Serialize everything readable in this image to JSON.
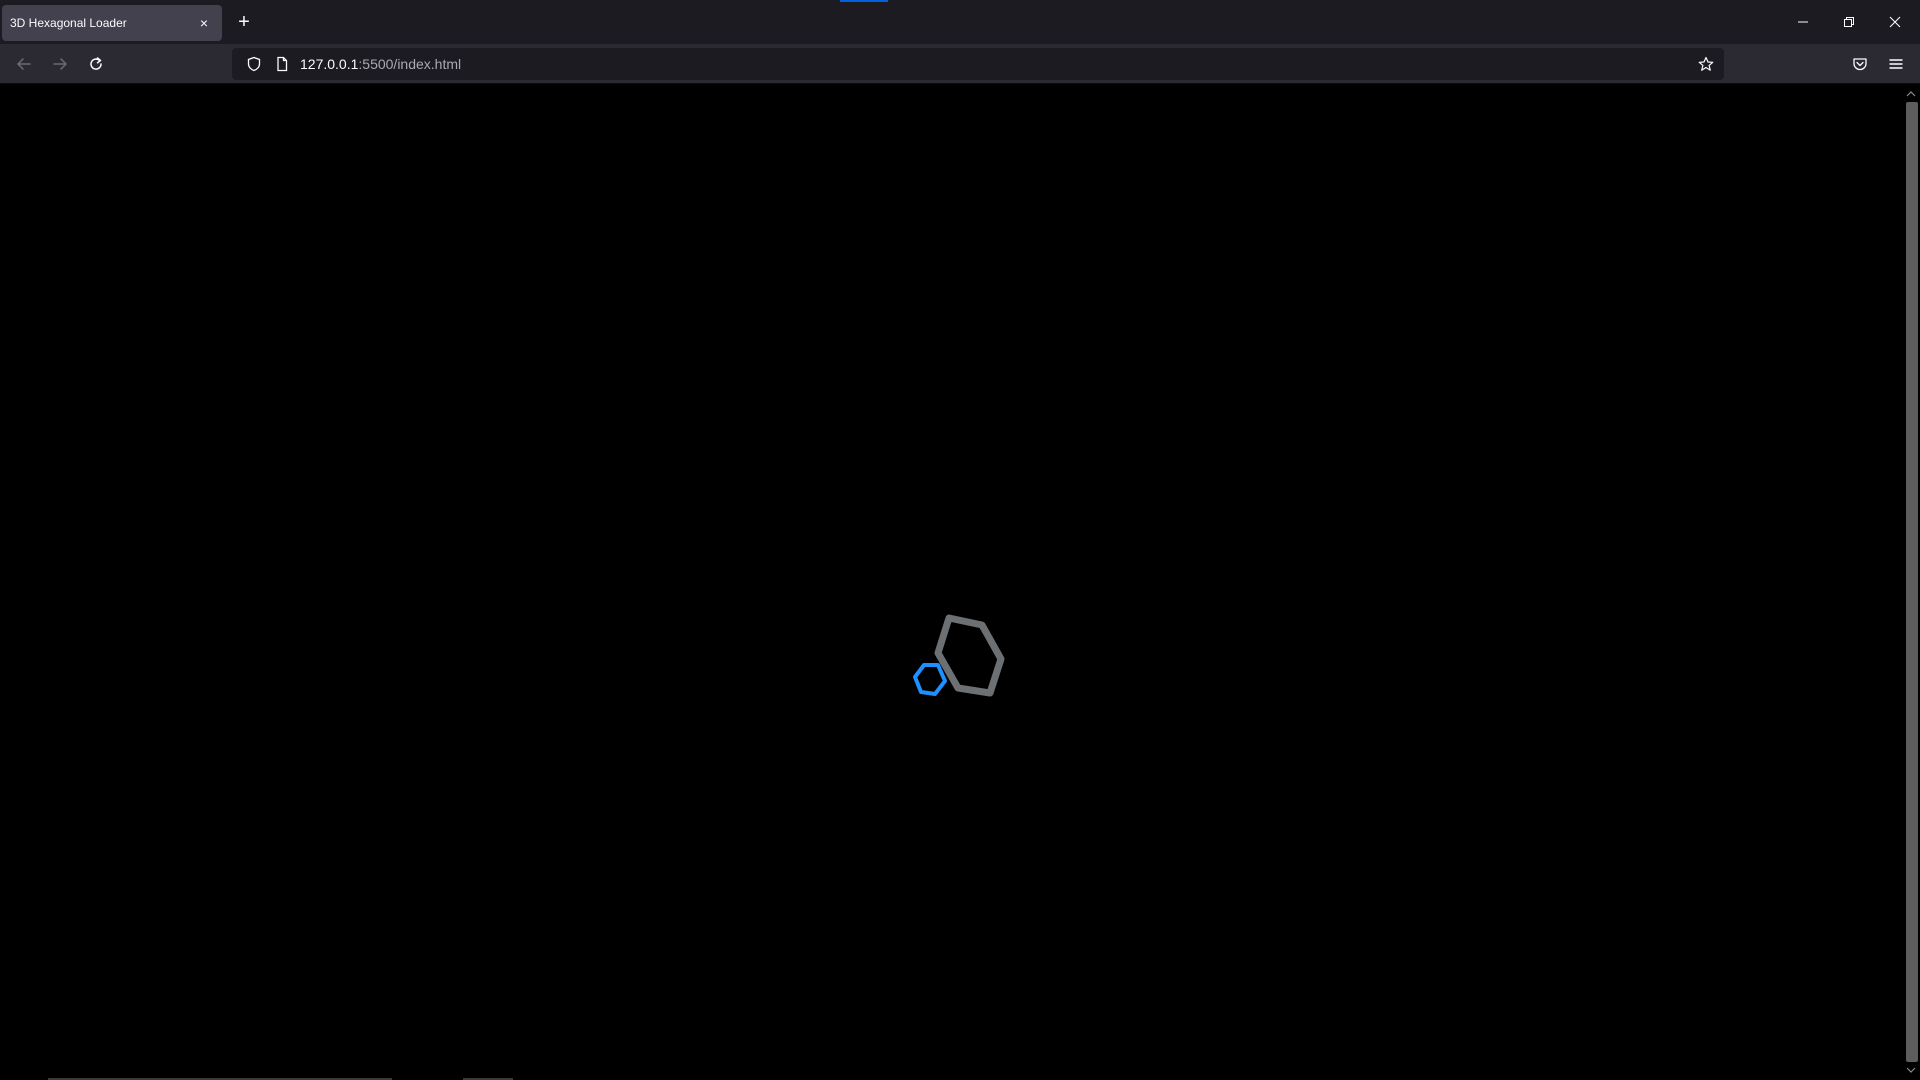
{
  "browser": {
    "tab": {
      "title": "3D Hexagonal Loader",
      "close_label": "×"
    },
    "new_tab_label": "+",
    "url": {
      "host": "127.0.0.1",
      "rest": ":5500/index.html"
    }
  },
  "loader": {
    "colors": {
      "large_hex": "#6c7073",
      "small_hex": "#1e90ff"
    }
  },
  "icons": {
    "back": "back-arrow-icon",
    "forward": "forward-arrow-icon",
    "reload": "reload-icon",
    "shield": "shield-icon",
    "page": "page-icon",
    "bookmark": "star-icon",
    "pocket": "pocket-icon",
    "menu": "hamburger-menu-icon",
    "minimize": "minimize-icon",
    "restore": "restore-icon",
    "close": "close-icon"
  }
}
